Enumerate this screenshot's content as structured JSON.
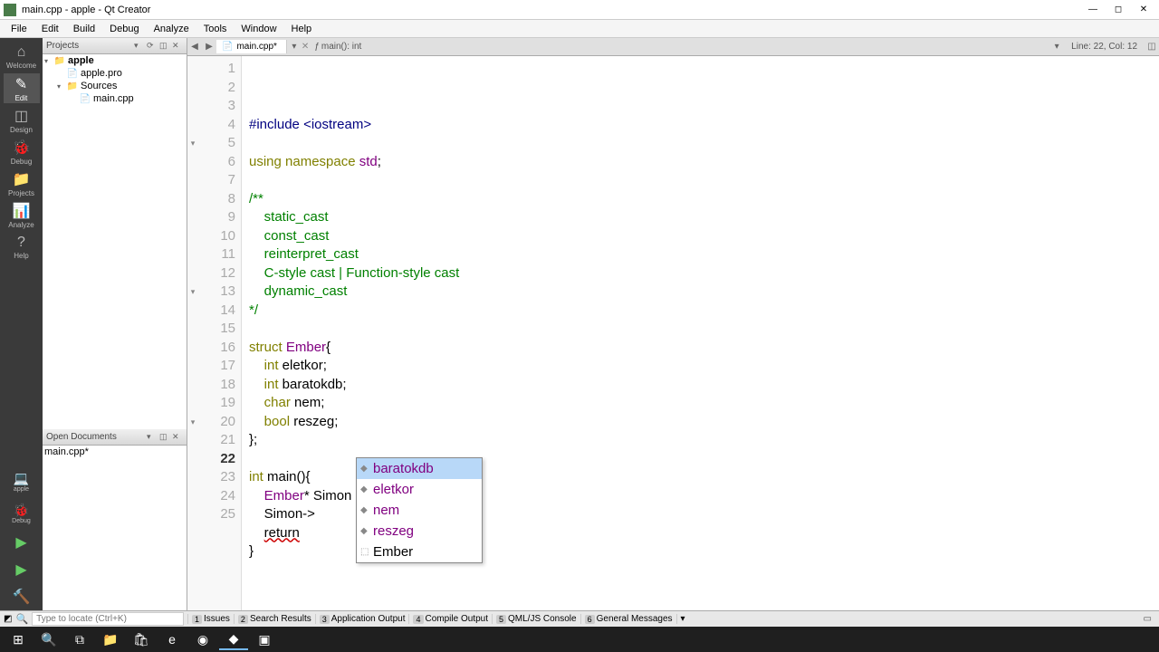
{
  "window": {
    "title": "main.cpp - apple - Qt Creator"
  },
  "menus": [
    "File",
    "Edit",
    "Build",
    "Debug",
    "Analyze",
    "Tools",
    "Window",
    "Help"
  ],
  "sidebar": [
    {
      "label": "Welcome",
      "icon": "⌂"
    },
    {
      "label": "Edit",
      "icon": "✎",
      "active": true
    },
    {
      "label": "Design",
      "icon": "◫"
    },
    {
      "label": "Debug",
      "icon": "🐞"
    },
    {
      "label": "Projects",
      "icon": "📁"
    },
    {
      "label": "Analyze",
      "icon": "📊"
    },
    {
      "label": "Help",
      "icon": "?"
    }
  ],
  "sidebar_bottom": [
    {
      "name": "target",
      "icon": "💻",
      "label": "apple"
    },
    {
      "name": "debug-sel",
      "icon": "🐞",
      "label": "Debug"
    },
    {
      "name": "run",
      "icon": "▶"
    },
    {
      "name": "run-debug",
      "icon": "▶"
    },
    {
      "name": "build",
      "icon": "🔨"
    }
  ],
  "projects": {
    "title": "Projects",
    "tree": [
      {
        "depth": 0,
        "toggle": "▾",
        "icon": "folder",
        "label": "apple",
        "bold": true
      },
      {
        "depth": 1,
        "toggle": "",
        "icon": "file",
        "label": "apple.pro"
      },
      {
        "depth": 1,
        "toggle": "▾",
        "icon": "folder",
        "label": "Sources"
      },
      {
        "depth": 2,
        "toggle": "",
        "icon": "file",
        "label": "main.cpp",
        "selected": false
      }
    ]
  },
  "opendocs": {
    "title": "Open Documents",
    "items": [
      "main.cpp*"
    ]
  },
  "tabs": {
    "file": "main.cpp*",
    "breadcrumb": "main(): int"
  },
  "status_right": "Line: 22, Col: 12",
  "code": {
    "lines": 25,
    "current_line": 22,
    "fold_lines": [
      5,
      13,
      20
    ],
    "content": [
      {
        "n": 1,
        "html": "<span class='pp'>#include</span> <span class='pp'>&lt;iostream&gt;</span>"
      },
      {
        "n": 2,
        "html": ""
      },
      {
        "n": 3,
        "html": "<span class='kw'>using</span> <span class='kw'>namespace</span> <span class='ty'>std</span>;"
      },
      {
        "n": 4,
        "html": ""
      },
      {
        "n": 5,
        "html": "<span class='cm'>/**</span>"
      },
      {
        "n": 6,
        "html": "<span class='cm'>    static_cast</span>"
      },
      {
        "n": 7,
        "html": "<span class='cm'>    const_cast</span>"
      },
      {
        "n": 8,
        "html": "<span class='cm'>    reinterpret_cast</span>"
      },
      {
        "n": 9,
        "html": "<span class='cm'>    C-style cast | Function-style cast</span>"
      },
      {
        "n": 10,
        "html": "<span class='cm'>    dynamic_cast</span>"
      },
      {
        "n": 11,
        "html": "<span class='cm'>*/</span>"
      },
      {
        "n": 12,
        "html": ""
      },
      {
        "n": 13,
        "html": "<span class='kw'>struct</span> <span class='ty'>Ember</span>{"
      },
      {
        "n": 14,
        "html": "    <span class='kw'>int</span> eletkor;"
      },
      {
        "n": 15,
        "html": "    <span class='kw'>int</span> baratokdb;"
      },
      {
        "n": 16,
        "html": "    <span class='kw'>char</span> nem;"
      },
      {
        "n": 17,
        "html": "    <span class='kw'>bool</span> reszeg;"
      },
      {
        "n": 18,
        "html": "};"
      },
      {
        "n": 19,
        "html": ""
      },
      {
        "n": 20,
        "html": "<span class='kw'>int</span> <span class='nm'>main</span>(){"
      },
      {
        "n": 21,
        "html": "    <span class='ty'>Ember</span>* Simon = <span class='kw'>new</span> <span class='ty'>Ember</span>;"
      },
      {
        "n": 22,
        "html": "    Simon-&gt;"
      },
      {
        "n": 23,
        "html": "    <span class='err'>return</span>"
      },
      {
        "n": 24,
        "html": "}"
      },
      {
        "n": 25,
        "html": ""
      }
    ]
  },
  "autocomplete": [
    {
      "icon": "◆",
      "text": "baratokdb",
      "selected": true,
      "type": false
    },
    {
      "icon": "◆",
      "text": "eletkor",
      "type": false
    },
    {
      "icon": "◆",
      "text": "nem",
      "type": false
    },
    {
      "icon": "◆",
      "text": "reszeg",
      "type": false
    },
    {
      "icon": "⬚",
      "text": "Ember",
      "type": true
    }
  ],
  "locator_placeholder": "Type to locate (Ctrl+K)",
  "status_panels": [
    {
      "num": "1",
      "label": "Issues"
    },
    {
      "num": "2",
      "label": "Search Results"
    },
    {
      "num": "3",
      "label": "Application Output"
    },
    {
      "num": "4",
      "label": "Compile Output"
    },
    {
      "num": "5",
      "label": "QML/JS Console"
    },
    {
      "num": "6",
      "label": "General Messages"
    }
  ]
}
